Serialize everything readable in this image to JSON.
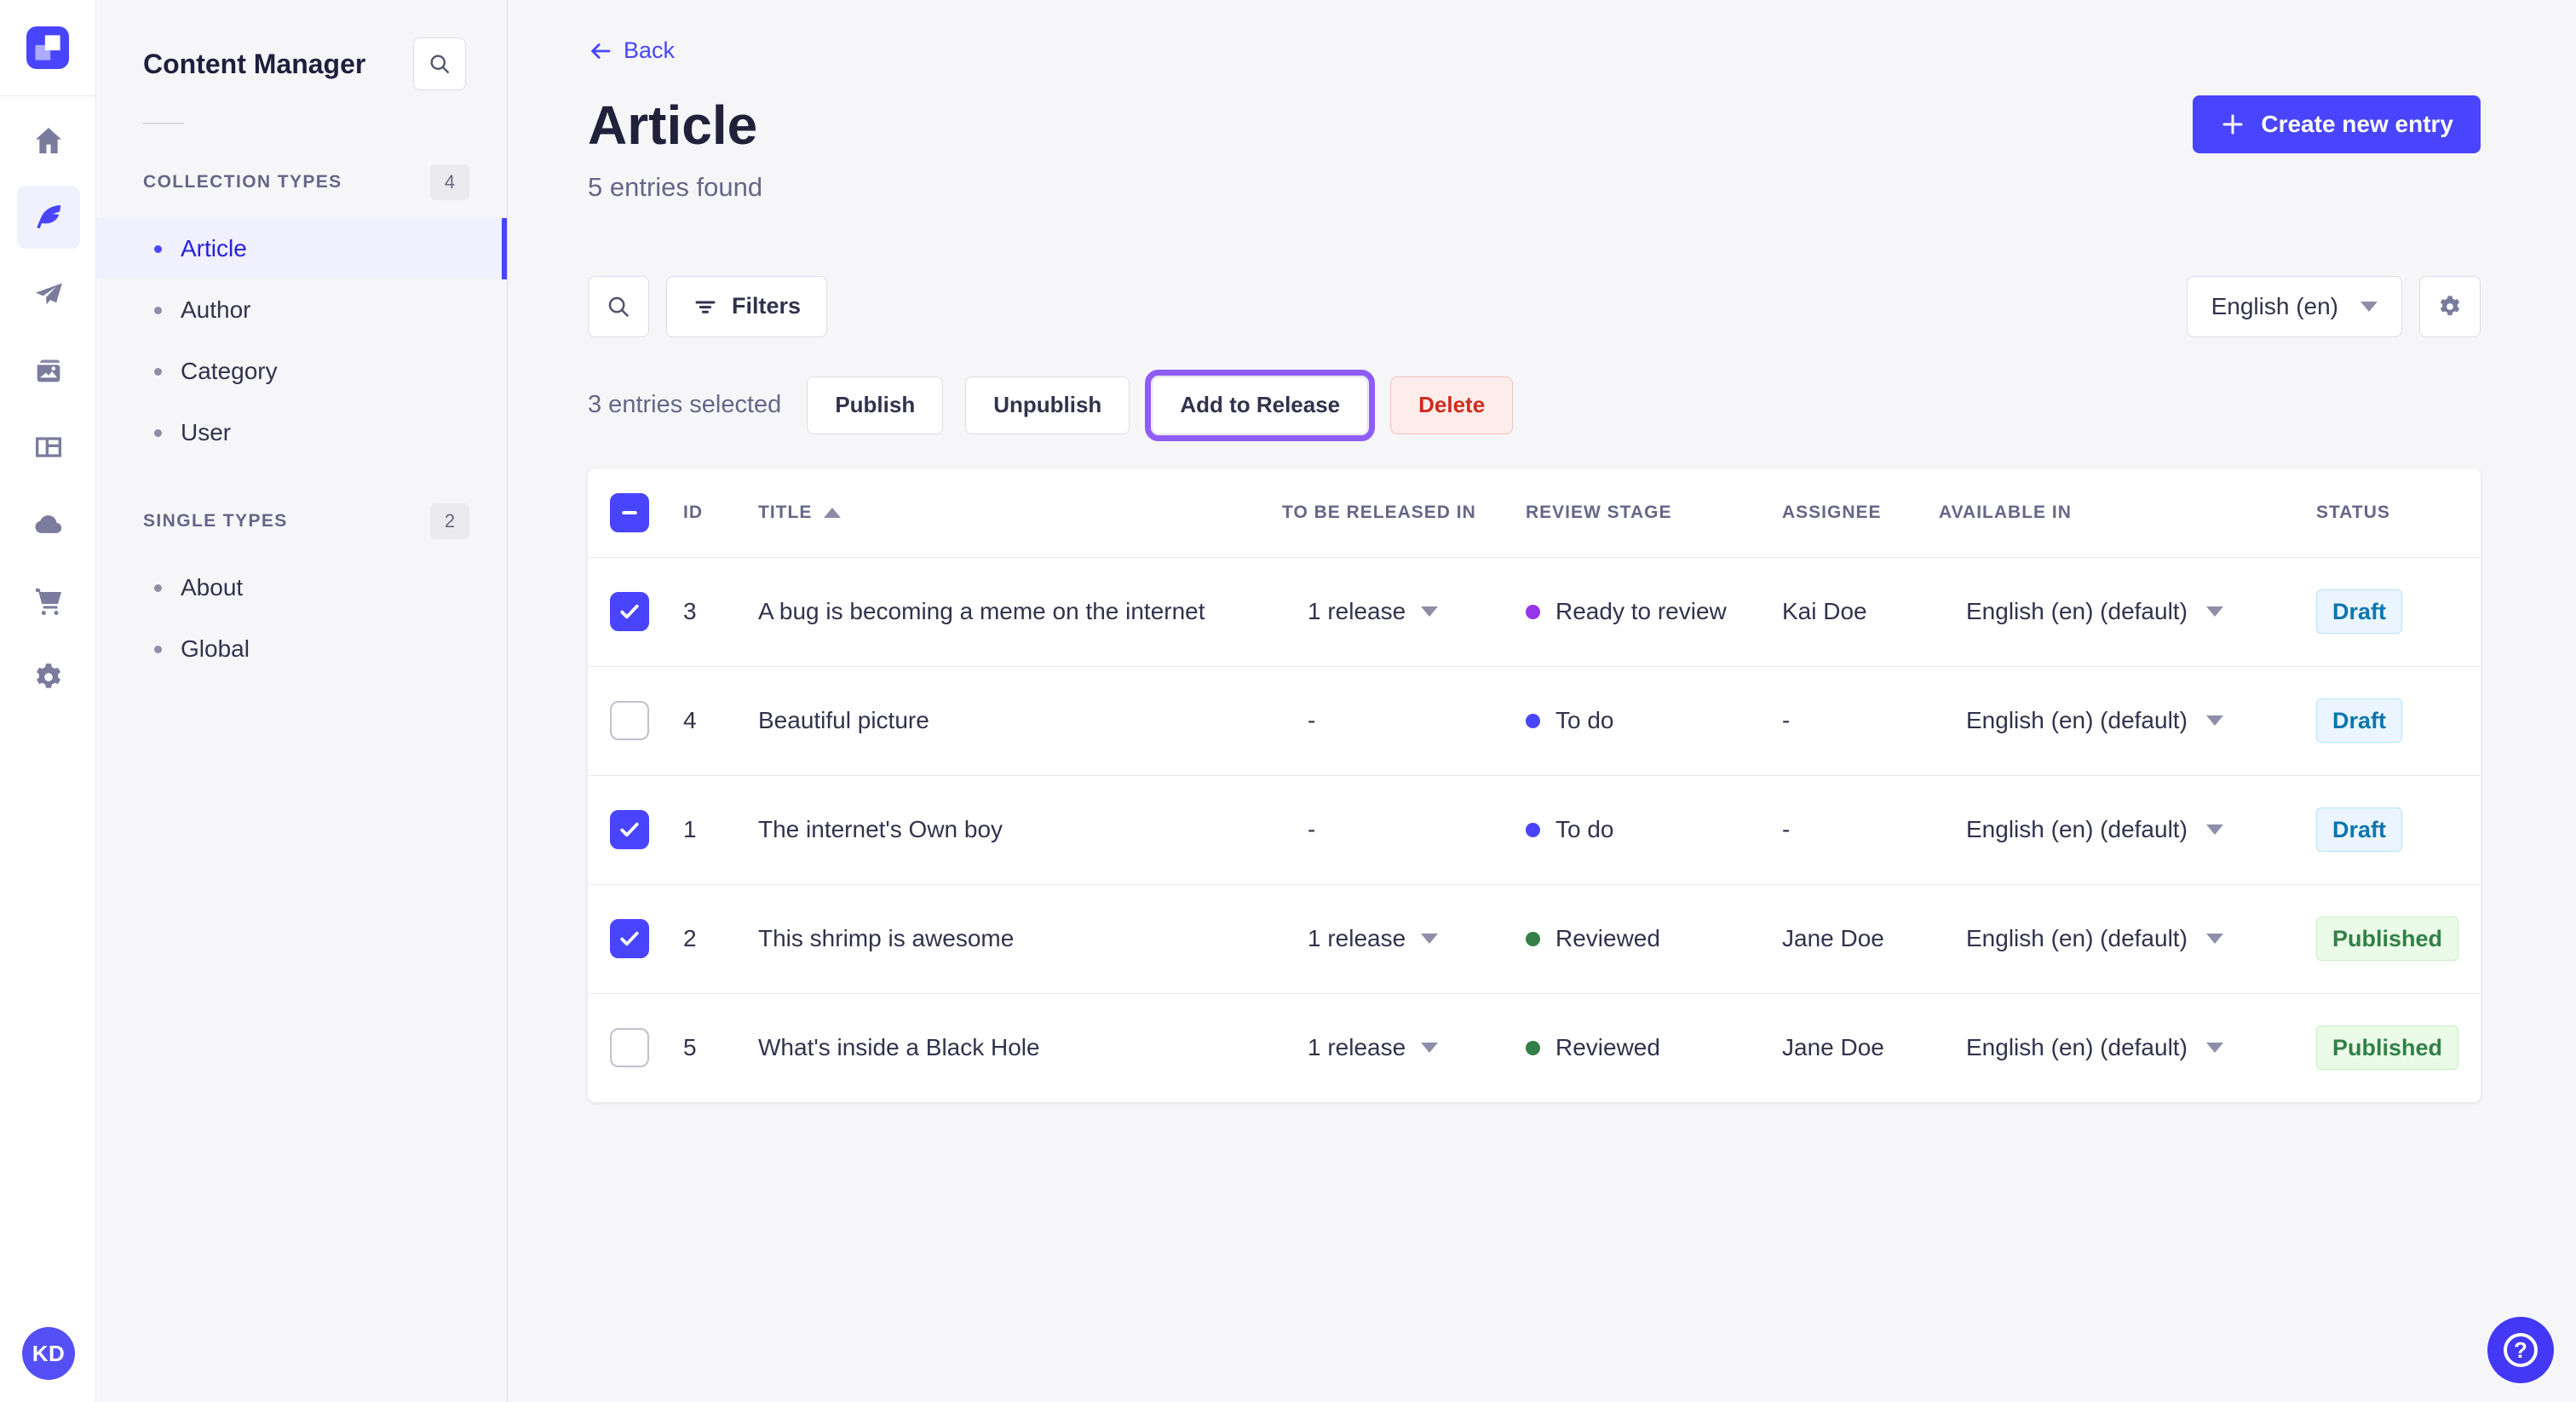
{
  "colors": {
    "accent": "#4945ff",
    "active_item_bg": "#f0f0ff",
    "highlight_ring": "#8e5cf6",
    "stage_todo": "#4945ff",
    "stage_ready_to_review": "#9736e8",
    "stage_reviewed": "#328048",
    "draft_badge_text": "#0c75af",
    "published_badge_text": "#328048",
    "delete_text": "#d02b20"
  },
  "nav_rail": {
    "icons": [
      {
        "name": "home-icon",
        "active": false
      },
      {
        "name": "feather-icon",
        "active": true
      },
      {
        "name": "paper-plane-icon",
        "active": false
      },
      {
        "name": "media-icon",
        "active": false
      },
      {
        "name": "layout-icon",
        "active": false
      },
      {
        "name": "cloud-icon",
        "active": false
      },
      {
        "name": "cart-icon",
        "active": false
      },
      {
        "name": "gear-icon",
        "active": false
      }
    ],
    "avatar_initials": "KD"
  },
  "sidebar": {
    "title": "Content Manager",
    "sections": [
      {
        "label": "COLLECTION TYPES",
        "count": "4",
        "items": [
          {
            "label": "Article",
            "active": true
          },
          {
            "label": "Author",
            "active": false
          },
          {
            "label": "Category",
            "active": false
          },
          {
            "label": "User",
            "active": false
          }
        ]
      },
      {
        "label": "SINGLE TYPES",
        "count": "2",
        "items": [
          {
            "label": "About",
            "active": false
          },
          {
            "label": "Global",
            "active": false
          }
        ]
      }
    ]
  },
  "header": {
    "back_label": "Back",
    "title": "Article",
    "subtitle": "5 entries found",
    "create_button_label": "Create new entry"
  },
  "toolbar": {
    "filters_label": "Filters",
    "locale_selected": "English (en)"
  },
  "selection": {
    "text": "3 entries selected",
    "publish_label": "Publish",
    "unpublish_label": "Unpublish",
    "add_to_release_label": "Add to Release",
    "delete_label": "Delete"
  },
  "table": {
    "columns": [
      "ID",
      "TITLE",
      "TO BE RELEASED IN",
      "REVIEW STAGE",
      "ASSIGNEE",
      "AVAILABLE IN",
      "STATUS"
    ],
    "sorted_column": "TITLE",
    "rows": [
      {
        "checked": true,
        "id": "3",
        "title": "A bug is becoming a meme on the internet",
        "release": "1 release",
        "stage": "Ready to review",
        "stage_color": "#9736e8",
        "assignee": "Kai Doe",
        "locale": "English (en) (default)",
        "status": "Draft"
      },
      {
        "checked": false,
        "id": "4",
        "title": "Beautiful picture",
        "release": "-",
        "stage": "To do",
        "stage_color": "#4945ff",
        "assignee": "-",
        "locale": "English (en) (default)",
        "status": "Draft"
      },
      {
        "checked": true,
        "id": "1",
        "title": "The internet's Own boy",
        "release": "-",
        "stage": "To do",
        "stage_color": "#4945ff",
        "assignee": "-",
        "locale": "English (en) (default)",
        "status": "Draft"
      },
      {
        "checked": true,
        "id": "2",
        "title": "This shrimp is awesome",
        "release": "1 release",
        "stage": "Reviewed",
        "stage_color": "#328048",
        "assignee": "Jane Doe",
        "locale": "English (en) (default)",
        "status": "Published"
      },
      {
        "checked": false,
        "id": "5",
        "title": "What's inside a Black Hole",
        "release": "1 release",
        "stage": "Reviewed",
        "stage_color": "#328048",
        "assignee": "Jane Doe",
        "locale": "English (en) (default)",
        "status": "Published"
      }
    ]
  },
  "help_fab": {
    "glyph": "?"
  }
}
